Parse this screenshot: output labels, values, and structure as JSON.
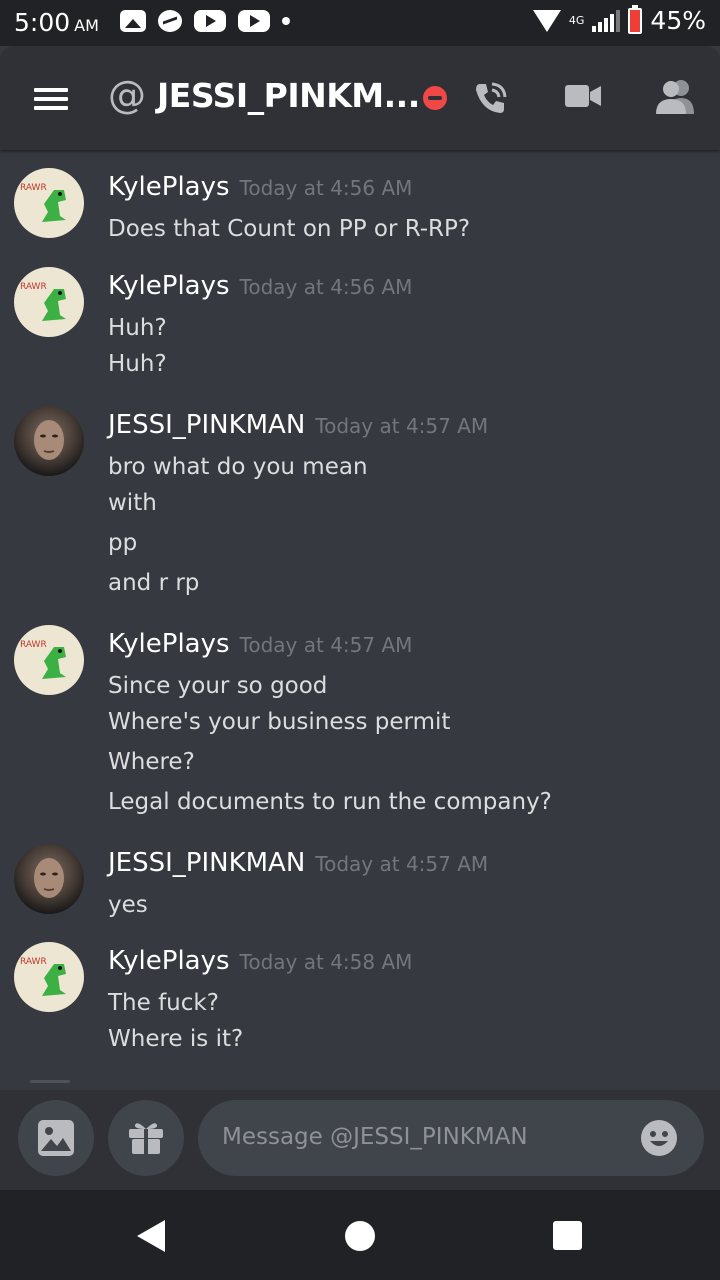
{
  "status_bar": {
    "time": "5:00",
    "ampm": "AM",
    "network": "4G",
    "battery": "45%"
  },
  "header": {
    "channel_title": "JESSI_PINKM...",
    "at_symbol": "@"
  },
  "messages": [
    {
      "author": "KylePlays",
      "timestamp": "Today at 4:56 AM",
      "avatar": "dinosaur-avatar",
      "lines": [
        "Does that Count on PP or R-RP?"
      ]
    },
    {
      "author": "KylePlays",
      "timestamp": "Today at 4:56 AM",
      "avatar": "dinosaur-avatar",
      "lines": [
        "Huh?",
        "Huh?"
      ]
    },
    {
      "author": "JESSI_PINKMAN",
      "timestamp": "Today at 4:57 AM",
      "avatar": "portrait-avatar",
      "lines": [
        "bro what do you mean",
        "with",
        "pp",
        "and r rp"
      ]
    },
    {
      "author": "KylePlays",
      "timestamp": "Today at 4:57 AM",
      "avatar": "dinosaur-avatar",
      "lines": [
        "Since your so good",
        "Where's your business permit",
        "Where?",
        "Legal documents to run the company?"
      ]
    },
    {
      "author": "JESSI_PINKMAN",
      "timestamp": "Today at 4:57 AM",
      "avatar": "portrait-avatar",
      "lines": [
        "yes"
      ]
    },
    {
      "author": "KylePlays",
      "timestamp": "Today at 4:58 AM",
      "avatar": "dinosaur-avatar",
      "lines": [
        "The fuck?",
        "Where is it?"
      ]
    }
  ],
  "composer": {
    "placeholder": "Message @JESSI_PINKMAN"
  },
  "colors": {
    "background": "#36393f",
    "header": "#2f3136",
    "status_bar": "#202225",
    "timestamp": "#72767d",
    "dnd": "#f04747"
  }
}
